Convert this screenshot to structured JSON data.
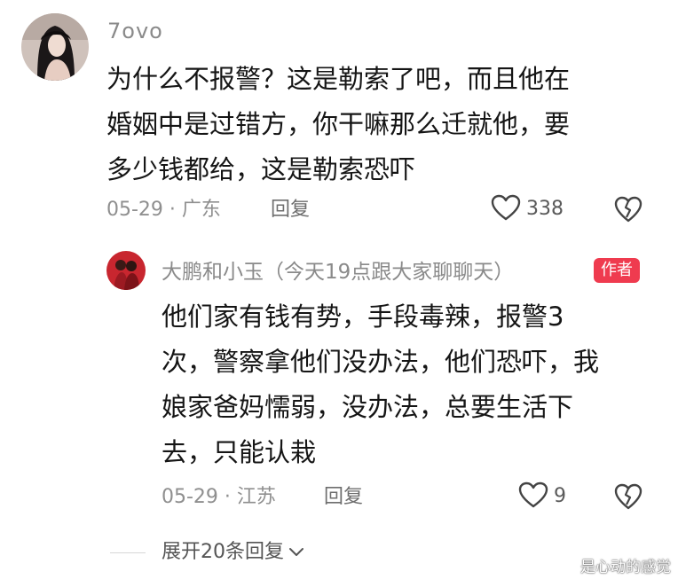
{
  "comment": {
    "username": "7ovo",
    "lines": [
      "为什么不报警？这是勒索了吧，而且他在",
      "婚姻中是过错方，你干嘛那么迁就他，要",
      "多少钱都给，这是勒索恐吓"
    ],
    "meta": "05-29 · 广东",
    "reply_label": "回复",
    "like_count": "338"
  },
  "reply": {
    "username": "大鹏和小玉（今天19点跟大家聊聊天）",
    "badge": "作者",
    "lines": [
      "他们家有钱有势，手段毒辣，报警3",
      "次，警察拿他们没办法，他们恐吓，我",
      "娘家爸妈懦弱，没办法，总要生活下",
      "去，只能认栽"
    ],
    "meta": "05-29 · 江苏",
    "reply_label": "回复",
    "like_count": "9"
  },
  "expand": {
    "label": "展开20条回复"
  },
  "watermark": "是心动的感觉",
  "colors": {
    "author_badge": "#ef3b4f",
    "meta_text": "#8f8f8f",
    "body_text": "#151515"
  },
  "icons": {
    "like": "heart-outline-icon",
    "dislike": "broken-heart-icon",
    "expand": "chevron-down-icon"
  }
}
